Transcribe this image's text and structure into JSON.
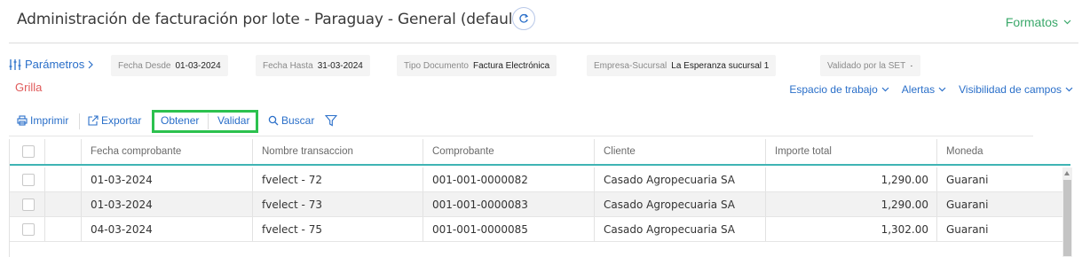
{
  "header": {
    "title": "Administración de facturación por lote - Paraguay - General (default)",
    "formatos_label": "Formatos"
  },
  "params": {
    "link_label": "Parámetros",
    "chips": [
      {
        "label": "Fecha Desde",
        "value": "01-03-2024"
      },
      {
        "label": "Fecha Hasta",
        "value": "31-03-2024"
      },
      {
        "label": "Tipo Documento",
        "value": "Factura Electrónica"
      },
      {
        "label": "Empresa-Sucursal",
        "value": "La Esperanza sucursal 1"
      },
      {
        "label": "Validado por la SET",
        "value": "·"
      }
    ]
  },
  "grilla_label": "Grilla",
  "right_menu": {
    "workspace": "Espacio de trabajo",
    "alerts": "Alertas",
    "fields_visibility": "Visibilidad de campos"
  },
  "toolbar": {
    "print": "Imprimir",
    "export": "Exportar",
    "obtain": "Obtener",
    "validate": "Validar",
    "search": "Buscar"
  },
  "table": {
    "columns": [
      "Fecha comprobante",
      "Nombre transaccion",
      "Comprobante",
      "Cliente",
      "Importe total",
      "Moneda"
    ],
    "rows": [
      {
        "fecha": "01-03-2024",
        "nombre": "fvelect - 72",
        "comprobante": "001-001-0000082",
        "cliente": "Casado Agropecuaria SA",
        "importe": "1,290.00",
        "moneda": "Guarani"
      },
      {
        "fecha": "01-03-2024",
        "nombre": "fvelect - 73",
        "comprobante": "001-001-0000083",
        "cliente": "Casado Agropecuaria SA",
        "importe": "1,290.00",
        "moneda": "Guarani"
      },
      {
        "fecha": "04-03-2024",
        "nombre": "fvelect - 75",
        "comprobante": "001-001-0000085",
        "cliente": "Casado Agropecuaria SA",
        "importe": "1,302.00",
        "moneda": "Guarani"
      }
    ]
  },
  "colors": {
    "accent_blue": "#2a6fc9",
    "brand_green": "#3aa86a",
    "highlight_green": "#2cc14e",
    "grilla_red": "#e05a5a",
    "header_underline": "#3fb4b4"
  }
}
